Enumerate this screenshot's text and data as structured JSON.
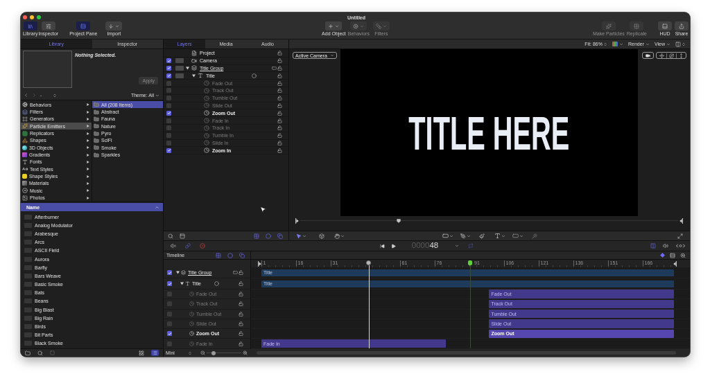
{
  "window": {
    "title": "Untitled"
  },
  "toolbar": {
    "left": [
      {
        "label": "Library",
        "selected": true,
        "disabled": false,
        "menu": false
      },
      {
        "label": "Inspector",
        "selected": false,
        "disabled": false,
        "menu": false
      },
      {
        "label": "Project Pane",
        "selected": true,
        "disabled": false,
        "menu": false
      },
      {
        "label": "Import",
        "selected": false,
        "disabled": false,
        "menu": true
      }
    ],
    "center": [
      {
        "label": "Add Object",
        "selected": false,
        "disabled": false,
        "menu": true
      },
      {
        "label": "Behaviors",
        "selected": false,
        "disabled": true,
        "menu": true
      },
      {
        "label": "Filters",
        "selected": false,
        "disabled": true,
        "menu": true
      }
    ],
    "right": [
      {
        "label": "Make Particles",
        "selected": false,
        "disabled": true,
        "menu": false
      },
      {
        "label": "Replicate",
        "selected": false,
        "disabled": true,
        "menu": false
      },
      {
        "label": "HUD",
        "selected": false,
        "disabled": false,
        "menu": false
      },
      {
        "label": "Share",
        "selected": false,
        "disabled": false,
        "menu": false
      }
    ]
  },
  "library_panel": {
    "tabs": [
      {
        "label": "Library",
        "selected": true
      },
      {
        "label": "Inspector",
        "selected": false
      }
    ],
    "preview": {
      "message": "Nothing Selected.",
      "apply": {
        "label": "Apply",
        "disabled": true
      }
    },
    "nav": {
      "path": "-",
      "theme": "Theme: All"
    },
    "categories": [
      {
        "label": "Behaviors",
        "selected": false
      },
      {
        "label": "Filters",
        "selected": false
      },
      {
        "label": "Generators",
        "selected": false
      },
      {
        "label": "Particle Emitters",
        "selected": true
      },
      {
        "label": "Replicators",
        "selected": false
      },
      {
        "label": "Shapes",
        "selected": false
      },
      {
        "label": "3D Objects",
        "selected": false
      },
      {
        "label": "Gradients",
        "selected": false
      },
      {
        "label": "Fonts",
        "selected": false
      },
      {
        "label": "Text Styles",
        "selected": false
      },
      {
        "label": "Shape Styles",
        "selected": false
      },
      {
        "label": "Materials",
        "selected": false
      },
      {
        "label": "Music",
        "selected": false
      },
      {
        "label": "Photos",
        "selected": false
      }
    ],
    "subcategories": [
      {
        "label": "All (208 Items)",
        "selected": true
      },
      {
        "label": "Abstract",
        "selected": false
      },
      {
        "label": "Fauna",
        "selected": false
      },
      {
        "label": "Nature",
        "selected": false
      },
      {
        "label": "Pyro",
        "selected": false
      },
      {
        "label": "SciFi",
        "selected": false
      },
      {
        "label": "Smoke",
        "selected": false
      },
      {
        "label": "Sparkles",
        "selected": false
      }
    ],
    "list": {
      "header": "Name",
      "items": [
        {
          "label": "Afterburner",
          "selected": false
        },
        {
          "label": "Analog Modulator",
          "selected": false
        },
        {
          "label": "Arabesque",
          "selected": false
        },
        {
          "label": "Arcs",
          "selected": false
        },
        {
          "label": "ASCII Field",
          "selected": false
        },
        {
          "label": "Aurora",
          "selected": false
        },
        {
          "label": "Barfly",
          "selected": false
        },
        {
          "label": "Bars Weave",
          "selected": false
        },
        {
          "label": "Basic Smoke",
          "selected": false
        },
        {
          "label": "Bats",
          "selected": false
        },
        {
          "label": "Beans",
          "selected": false
        },
        {
          "label": "Big Blast",
          "selected": false
        },
        {
          "label": "Big Rain",
          "selected": false
        },
        {
          "label": "Birds",
          "selected": false
        },
        {
          "label": "Bit Parts",
          "selected": false
        },
        {
          "label": "Black Smoke",
          "selected": false
        }
      ]
    }
  },
  "layers_panel": {
    "tabs": [
      {
        "label": "Layers",
        "selected": true
      },
      {
        "label": "Media",
        "selected": false
      },
      {
        "label": "Audio",
        "selected": false
      }
    ],
    "layers": [
      {
        "name": "Project",
        "kind": "project"
      },
      {
        "name": "Camera",
        "kind": "camera",
        "checked": true
      },
      {
        "name": "Title Group",
        "kind": "group",
        "checked": true,
        "expanded": true,
        "children": [
          {
            "name": "Title",
            "kind": "layer",
            "checked": true,
            "expanded": true,
            "children": [
              {
                "name": "Fade Out",
                "kind": "behavior",
                "checked": false
              },
              {
                "name": "Track Out",
                "kind": "behavior",
                "checked": false
              },
              {
                "name": "Tumble Out",
                "kind": "behavior",
                "checked": false
              },
              {
                "name": "Slide Out",
                "kind": "behavior",
                "checked": false
              },
              {
                "name": "Zoom Out",
                "kind": "behavior",
                "checked": true
              },
              {
                "name": "Fade In",
                "kind": "behavior",
                "checked": false
              },
              {
                "name": "Track In",
                "kind": "behavior",
                "checked": false
              },
              {
                "name": "Tumble In",
                "kind": "behavior",
                "checked": false
              },
              {
                "name": "Slide In",
                "kind": "behavior",
                "checked": false
              },
              {
                "name": "Zoom In",
                "kind": "behavior",
                "checked": true
              }
            ]
          }
        ]
      }
    ]
  },
  "viewer": {
    "zoom": "Fit: 86%",
    "render": "Render",
    "view": "View",
    "camera": "Active Camera",
    "canvas_text": "TITLE HERE",
    "scrubber": {
      "level": 0.26
    }
  },
  "transport": {
    "timecode_lead": "0000",
    "timecode": "48"
  },
  "timeline": {
    "title": "Timeline",
    "ruler": [
      {
        "label": "1",
        "marker": false
      },
      {
        "label": "16",
        "marker": false
      },
      {
        "label": "31",
        "marker": false
      },
      {
        "label": "61",
        "marker": false
      },
      {
        "label": "76",
        "marker": false
      },
      {
        "label": "91",
        "marker": true
      },
      {
        "label": "106",
        "marker": false
      },
      {
        "label": "121",
        "marker": false
      },
      {
        "label": "136",
        "marker": false
      },
      {
        "label": "151",
        "marker": false
      },
      {
        "label": "166",
        "marker": false
      }
    ],
    "playhead": {
      "level": 0.26
    },
    "rows": [
      {
        "name": "Title Group",
        "kind": "group",
        "checked": true,
        "expanded": true,
        "bar": {
          "label": "Title",
          "kind": "whole"
        },
        "children": [
          {
            "name": "Title",
            "kind": "layer",
            "checked": true,
            "expanded": true,
            "bar": {
              "label": "Title",
              "kind": "whole"
            },
            "children": [
              {
                "name": "Fade Out",
                "kind": "behavior",
                "checked": false,
                "bar": {
                  "label": "Fade Out",
                  "kind": "end"
                }
              },
              {
                "name": "Track Out",
                "kind": "behavior",
                "checked": false,
                "bar": {
                  "label": "Track Out",
                  "kind": "end"
                }
              },
              {
                "name": "Tumble Out",
                "kind": "behavior",
                "checked": false,
                "bar": {
                  "label": "Tumble Out",
                  "kind": "end"
                }
              },
              {
                "name": "Slide Out",
                "kind": "behavior",
                "checked": false,
                "bar": {
                  "label": "Slide Out",
                  "kind": "end"
                }
              },
              {
                "name": "Zoom Out",
                "kind": "behavior",
                "checked": true,
                "bar": {
                  "label": "Zoom Out",
                  "kind": "end"
                }
              },
              {
                "name": "Fade In",
                "kind": "behavior",
                "checked": false,
                "bar": {
                  "label": "Fade In",
                  "kind": "start"
                }
              }
            ]
          }
        ]
      }
    ]
  },
  "bottom_bar": {
    "view_size": "Mini",
    "zoom": {
      "level": 0.2
    }
  }
}
